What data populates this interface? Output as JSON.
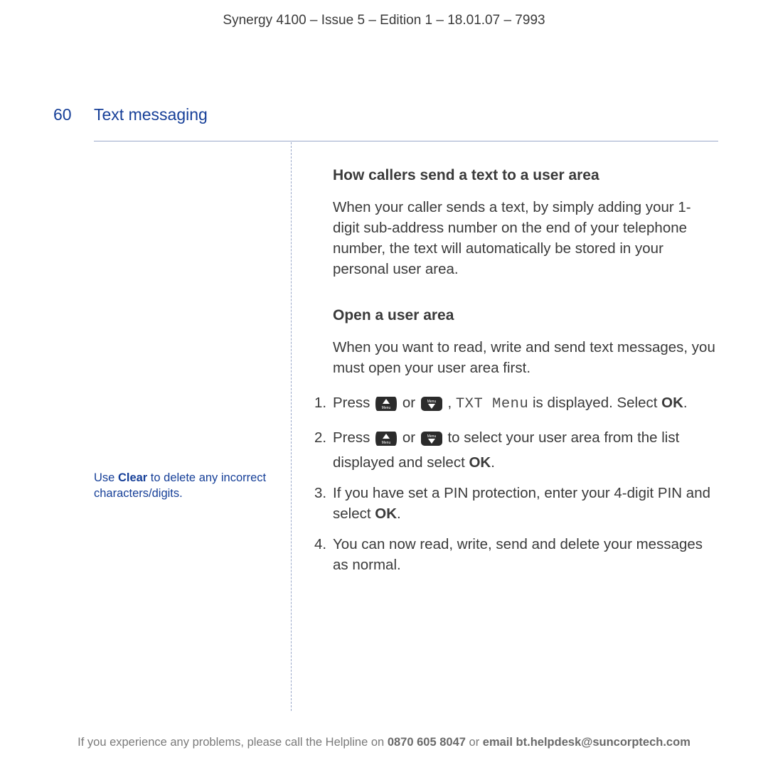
{
  "header": "Synergy 4100 – Issue 5 – Edition 1 – 18.01.07 – 7993",
  "page_number": "60",
  "section_title": "Text messaging",
  "subsection1": {
    "heading": "How callers send a text to a user area",
    "body": "When your caller sends a text, by simply adding your 1-digit sub-address number on the end of your telephone number, the text will automatically be stored in your personal user area."
  },
  "subsection2": {
    "heading": "Open a user area",
    "intro": "When you want to read, write and send text messages, you must open your user area first.",
    "s1_pre": "Press ",
    "s1_or": " or ",
    "s1_comma": ", ",
    "s1_display": "TXT Menu",
    "s1_mid": " is displayed. Select ",
    "s1_ok": "OK",
    "s1_end": ".",
    "s2_pre": "Press ",
    "s2_or": " or ",
    "s2_mid": " to select your user area from the list displayed and select ",
    "s2_ok": "OK",
    "s2_end": ".",
    "s3_a": "If you have set a PIN protection, enter your 4-digit PIN and select ",
    "s3_ok": "OK",
    "s3_end": ".",
    "s4": "You can now read, write, send and delete your messages as normal.",
    "n1": "1.",
    "n2": "2.",
    "n3": "3.",
    "n4": "4."
  },
  "margin_note": {
    "pre": "Use ",
    "clear": "Clear",
    "post": " to delete any incorrect characters/digits."
  },
  "footer": {
    "pre": "If you experience any problems, please call the Helpline on ",
    "phone": "0870 605 8047",
    "mid": " or ",
    "email_label": "email bt.helpdesk@suncorptech.com"
  },
  "icons": {
    "menu_up": "menu-up-button-icon",
    "menu_down": "menu-down-button-icon"
  }
}
